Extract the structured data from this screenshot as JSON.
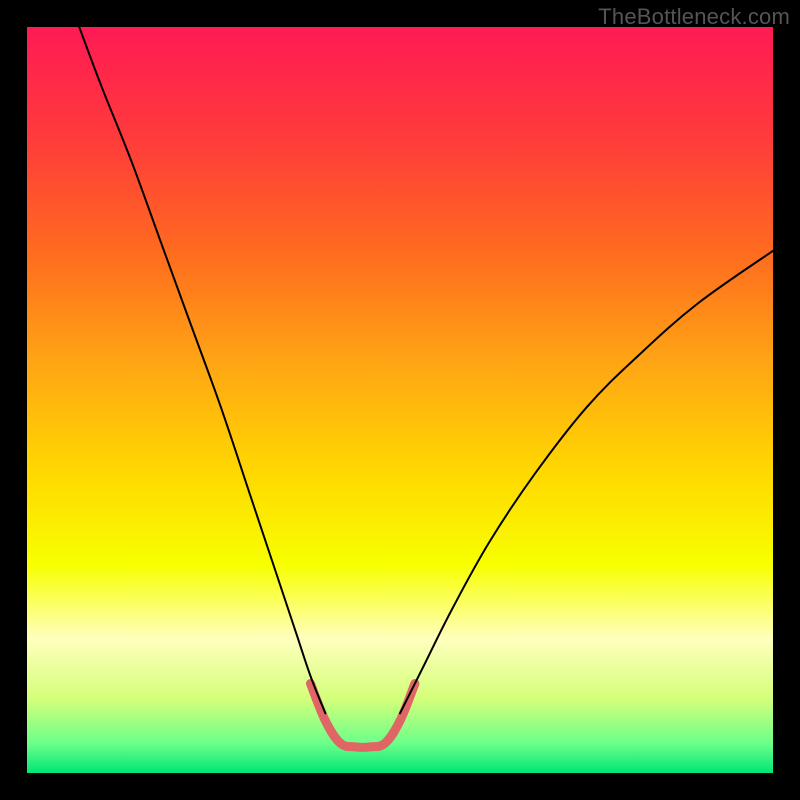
{
  "watermark": "TheBottleneck.com",
  "chart_data": {
    "type": "line",
    "title": "",
    "xlabel": "",
    "ylabel": "",
    "xlim": [
      0,
      100
    ],
    "ylim": [
      0,
      100
    ],
    "background": {
      "type": "vertical_gradient",
      "stops": [
        {
          "offset": 0.0,
          "color": "#ff1a54"
        },
        {
          "offset": 0.15,
          "color": "#ff3b3b"
        },
        {
          "offset": 0.3,
          "color": "#ff6a1f"
        },
        {
          "offset": 0.45,
          "color": "#ffa514"
        },
        {
          "offset": 0.6,
          "color": "#ffd900"
        },
        {
          "offset": 0.72,
          "color": "#f7ff00"
        },
        {
          "offset": 0.82,
          "color": "#ffffbd"
        },
        {
          "offset": 0.9,
          "color": "#d4ff7a"
        },
        {
          "offset": 0.96,
          "color": "#6cff8a"
        },
        {
          "offset": 1.0,
          "color": "#00e676"
        }
      ]
    },
    "series": [
      {
        "name": "curve-left",
        "color": "#000000",
        "width": 2,
        "points": [
          {
            "x": 7,
            "y": 100
          },
          {
            "x": 10,
            "y": 92
          },
          {
            "x": 14,
            "y": 82
          },
          {
            "x": 18,
            "y": 71
          },
          {
            "x": 22,
            "y": 60
          },
          {
            "x": 26,
            "y": 49
          },
          {
            "x": 30,
            "y": 37
          },
          {
            "x": 33,
            "y": 28
          },
          {
            "x": 36,
            "y": 19
          },
          {
            "x": 38,
            "y": 13
          },
          {
            "x": 40,
            "y": 8
          }
        ]
      },
      {
        "name": "curve-right",
        "color": "#000000",
        "width": 2,
        "points": [
          {
            "x": 50,
            "y": 8
          },
          {
            "x": 53,
            "y": 14
          },
          {
            "x": 57,
            "y": 22
          },
          {
            "x": 62,
            "y": 31
          },
          {
            "x": 68,
            "y": 40
          },
          {
            "x": 75,
            "y": 49
          },
          {
            "x": 82,
            "y": 56
          },
          {
            "x": 90,
            "y": 63
          },
          {
            "x": 100,
            "y": 70
          }
        ]
      },
      {
        "name": "bottom-highlight",
        "color": "#e06666",
        "width": 9,
        "points": [
          {
            "x": 38,
            "y": 12
          },
          {
            "x": 40,
            "y": 7
          },
          {
            "x": 42,
            "y": 4
          },
          {
            "x": 44,
            "y": 3.5
          },
          {
            "x": 46,
            "y": 3.5
          },
          {
            "x": 48,
            "y": 4
          },
          {
            "x": 50,
            "y": 7
          },
          {
            "x": 52,
            "y": 12
          }
        ]
      }
    ]
  }
}
